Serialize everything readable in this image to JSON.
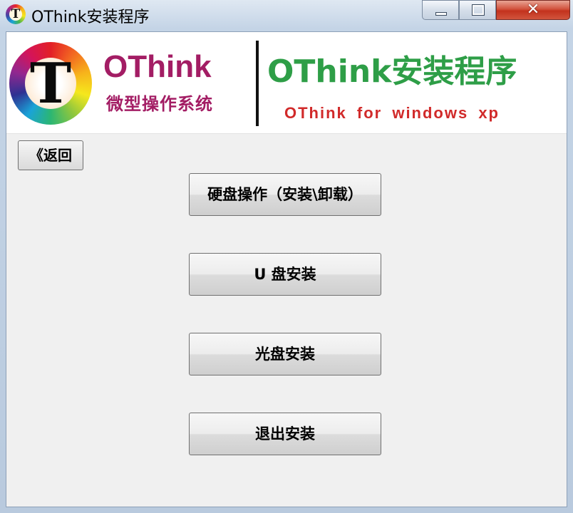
{
  "window": {
    "title": "OThink安装程序",
    "icon_letter": "T",
    "close_glyph": "✕"
  },
  "banner": {
    "logo_letter": "T",
    "brand": "OThink",
    "brand_sub": "微型操作系统",
    "title": "OThink安装程序",
    "subtitle": "OThink  for  windows  xp",
    "colors": {
      "brand": "#a31d64",
      "title": "#2e9e47",
      "subtitle": "#d12a2a"
    }
  },
  "buttons": {
    "back": "《返回",
    "disk": "硬盘操作（安装\\卸载）",
    "usb": "U 盘安装",
    "cd": "光盘安装",
    "exit": "退出安装"
  }
}
